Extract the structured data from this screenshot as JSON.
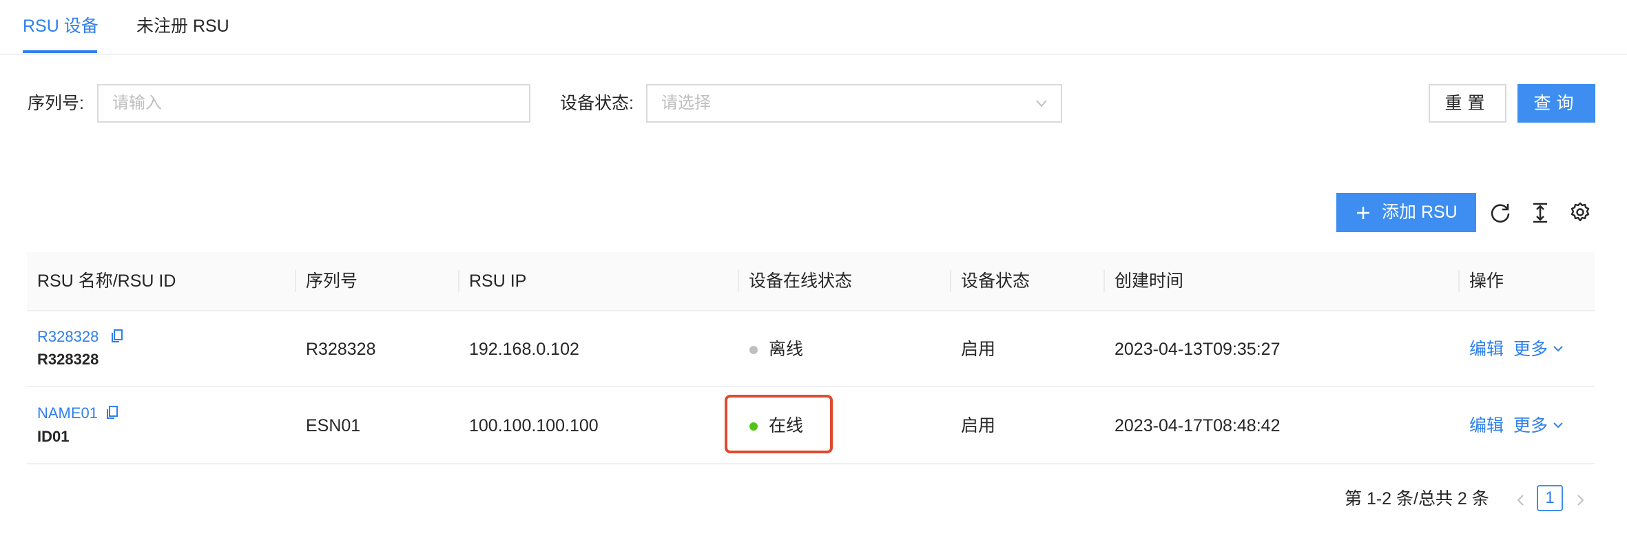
{
  "tabs": [
    {
      "label": "RSU 设备",
      "active": true
    },
    {
      "label": "未注册 RSU",
      "active": false
    }
  ],
  "search": {
    "serial_label": "序列号:",
    "serial_placeholder": "请输入",
    "serial_value": "",
    "status_label": "设备状态:",
    "status_placeholder": "请选择",
    "reset_label": "重置",
    "query_label": "查询"
  },
  "toolbar": {
    "add_label": "添加 RSU",
    "icons": [
      "reload-icon",
      "column-height-icon",
      "setting-icon"
    ]
  },
  "table": {
    "columns": [
      "RSU 名称/RSU ID",
      "序列号",
      "RSU IP",
      "设备在线状态",
      "设备状态",
      "创建时间",
      "操作"
    ],
    "rows": [
      {
        "name": "R328328",
        "id": "R328328",
        "serial": "R328328",
        "ip": "192.168.0.102",
        "online_status": "离线",
        "online_color": "#bfbfbf",
        "device_status": "启用",
        "created": "2023-04-13T09:35:27",
        "action_edit": "编辑",
        "action_more": "更多"
      },
      {
        "name": "NAME01",
        "id": "ID01",
        "serial": "ESN01",
        "ip": "100.100.100.100",
        "online_status": "在线",
        "online_color": "#52c41a",
        "device_status": "启用",
        "created": "2023-04-17T08:48:42",
        "action_edit": "编辑",
        "action_more": "更多"
      }
    ]
  },
  "pagination": {
    "summary": "第 1-2 条/总共 2 条",
    "current_page": "1"
  },
  "colors": {
    "accent": "#3d8ef0",
    "highlight_box": "#e04a2f"
  }
}
